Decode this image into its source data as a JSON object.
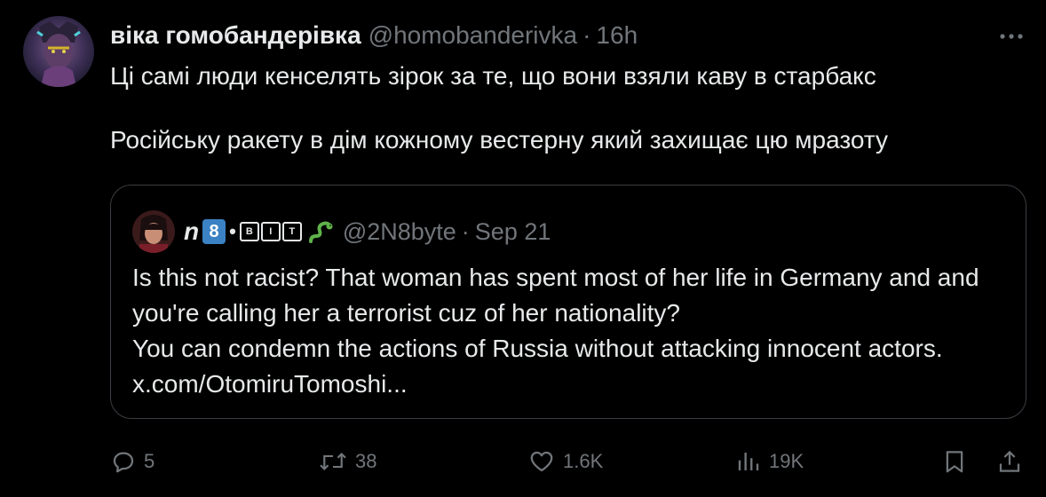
{
  "tweet": {
    "display_name": "віка гомобандерівка",
    "handle": "@homobanderivka",
    "separator": "·",
    "time": "16h",
    "text_line1": "Ці самі люди кенселять зірок за те, що вони взяли каву в старбакс",
    "text_line2": "Російську ракету в дім кожному вестерну який захищає цю мразоту"
  },
  "quote": {
    "display_name_prefix": "n",
    "display_name_emoji_number": "8",
    "display_name_dot": "•",
    "display_name_letters": [
      "B",
      "I",
      "T"
    ],
    "handle": "@2N8byte",
    "separator": "·",
    "time": "Sep 21",
    "text": "Is this not racist? That woman has spent most of her life in Germany and and you're calling her a terrorist cuz of her nationality?",
    "text_line2": "You can condemn the actions of Russia without attacking innocent actors. x.com/OtomiruTomoshi..."
  },
  "actions": {
    "replies": "5",
    "reposts": "38",
    "likes": "1.6K",
    "views": "19K"
  },
  "icons": {
    "more": "more-horizontal-icon",
    "reply": "reply-icon",
    "repost": "repost-icon",
    "like": "heart-icon",
    "views": "views-icon",
    "bookmark": "bookmark-icon",
    "share": "share-icon",
    "snake_emoji": "snake-icon"
  },
  "colors": {
    "background": "#000000",
    "text": "#e7e9ea",
    "muted": "#71767b",
    "border": "#3a3d42",
    "emoji_blue": "#3b82c4"
  }
}
